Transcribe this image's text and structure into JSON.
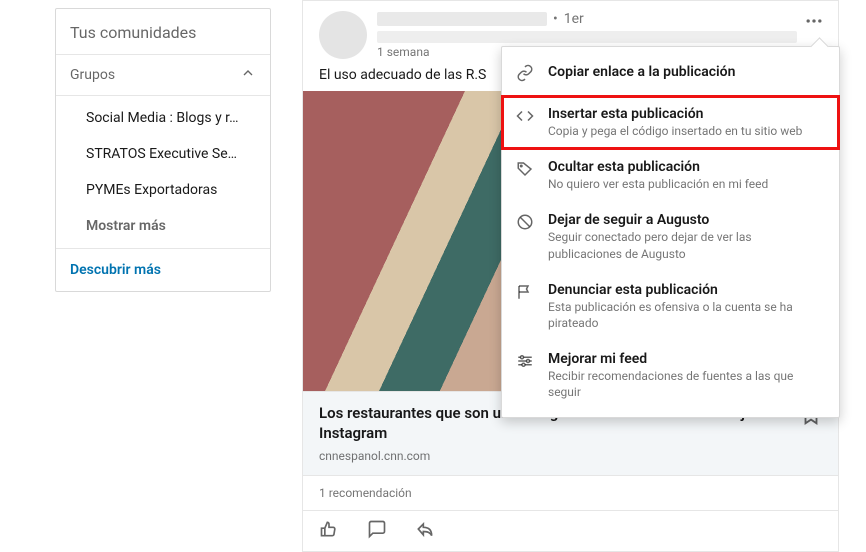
{
  "sidebar": {
    "header": "Tus comunidades",
    "groups_label": "Grupos",
    "items": [
      "Social Media : Blogs y r…",
      "STRATOS Executive Se…",
      "PYMEs Exportadoras",
      "Mostrar más"
    ],
    "discover_label": "Descubrir más"
  },
  "post": {
    "connection_degree": "1er",
    "time": "1 semana",
    "text_prefix": "El uso adecuado de las R.S",
    "link": {
      "title": "Los restaurantes que son un éxito gracias a un excelente manejo de Instagram",
      "domain": "cnnespanol.cnn.com"
    },
    "stats": "1 recomendación"
  },
  "menu": {
    "items": [
      {
        "icon": "link",
        "title": "Copiar enlace a la publicación"
      },
      {
        "icon": "embed",
        "title": "Insertar esta publicación",
        "desc": "Copia y pega el código insertado en tu sitio web",
        "highlight": true
      },
      {
        "icon": "hide",
        "title": "Ocultar esta publicación",
        "desc": "No quiero ver esta publicación en mi feed"
      },
      {
        "icon": "unfollow",
        "title": "Dejar de seguir a Augusto",
        "desc": "Seguir conectado pero dejar de ver las publicaciones de Augusto"
      },
      {
        "icon": "report",
        "title": "Denunciar esta publicación",
        "desc": "Esta publicación es ofensiva o la cuenta se ha pirateado"
      },
      {
        "icon": "tune",
        "title": "Mejorar mi feed",
        "desc": "Recibir recomendaciones de fuentes a las que seguir"
      }
    ]
  }
}
